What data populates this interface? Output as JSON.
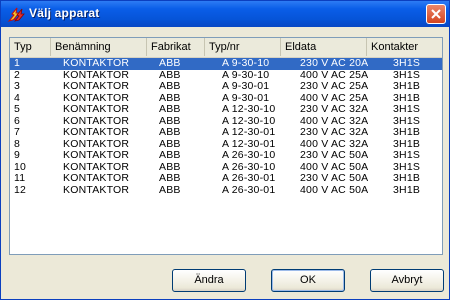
{
  "window": {
    "title": "Välj apparat"
  },
  "columns": [
    "Typ",
    "Benämning",
    "Fabrikat",
    "Typ/nr",
    "Eldata",
    "Kontakter"
  ],
  "rows": [
    [
      "1",
      "KONTAKTOR",
      "ABB",
      "A 9-30-10",
      "230 V AC 20A",
      "3H1S"
    ],
    [
      "2",
      "KONTAKTOR",
      "ABB",
      "A 9-30-10",
      "400 V AC 25A",
      "3H1S"
    ],
    [
      "3",
      "KONTAKTOR",
      "ABB",
      "A 9-30-01",
      "230 V AC 25A",
      "3H1B"
    ],
    [
      "4",
      "KONTAKTOR",
      "ABB",
      "A 9-30-01",
      "400 V AC 25A",
      "3H1B"
    ],
    [
      "5",
      "KONTAKTOR",
      "ABB",
      "A 12-30-10",
      "230 V AC 32A",
      "3H1S"
    ],
    [
      "6",
      "KONTAKTOR",
      "ABB",
      "A 12-30-10",
      "400 V AC 32A",
      "3H1S"
    ],
    [
      "7",
      "KONTAKTOR",
      "ABB",
      "A 12-30-01",
      "230 V AC 32A",
      "3H1B"
    ],
    [
      "8",
      "KONTAKTOR",
      "ABB",
      "A 12-30-01",
      "400 V AC 32A",
      "3H1B"
    ],
    [
      "9",
      "KONTAKTOR",
      "ABB",
      "A 26-30-10",
      "230 V AC 50A",
      "3H1S"
    ],
    [
      "10",
      "KONTAKTOR",
      "ABB",
      "A 26-30-10",
      "400 V AC 50A",
      "3H1S"
    ],
    [
      "11",
      "KONTAKTOR",
      "ABB",
      "A 26-30-01",
      "230 V AC 50A",
      "3H1B"
    ],
    [
      "12",
      "KONTAKTOR",
      "ABB",
      "A 26-30-01",
      "400 V AC 50A",
      "3H1B"
    ]
  ],
  "selected_row": 0,
  "buttons": {
    "edit": "Ändra",
    "ok": "OK",
    "cancel": "Avbryt"
  },
  "icons": {
    "app": "lightning-bolt-icon",
    "close": "close-icon"
  },
  "colors": {
    "selection": "#316ac5",
    "titlebar": "#0654d8",
    "close": "#d4451f"
  }
}
